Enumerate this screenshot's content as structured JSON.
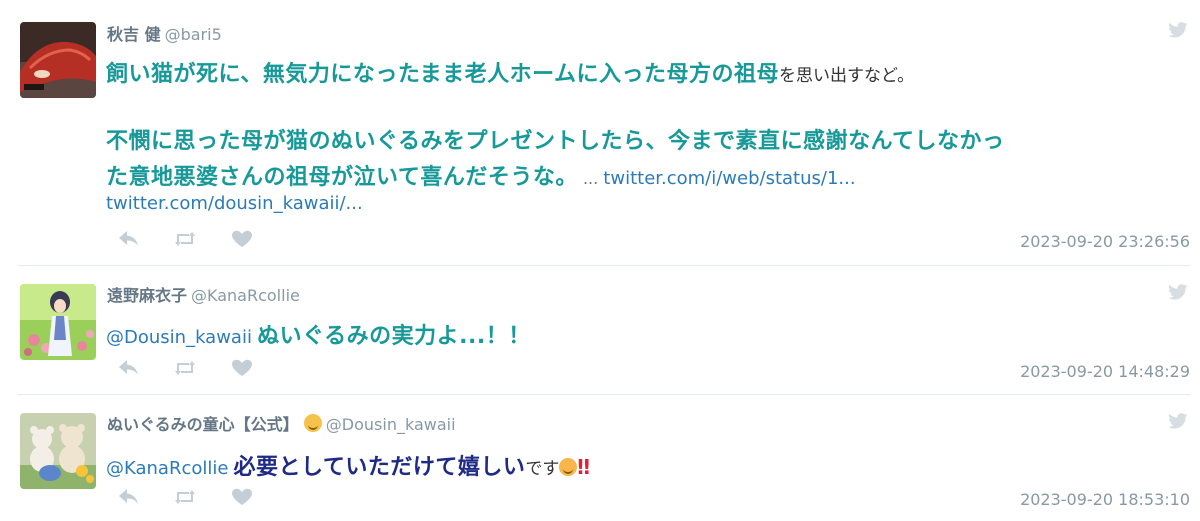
{
  "tweets": [
    {
      "name": "秋吉 健",
      "handle": "@bari5",
      "line1_highlight": "飼い猫が死に、無気力になったまま老人ホームに入った母方の祖母",
      "line1_plain": "を思い出すなど。",
      "line2_highlight": "不憫に思った母が猫のぬいぐるみをプレゼントしたら、今まで素直に感謝なんてしなかっ",
      "line3_highlight": "た意地悪婆さんの祖母が泣いて喜んだそうな。",
      "line3_ellipsis": "...",
      "line3_link": "twitter.com/i/web/status/1...",
      "line4_link": "twitter.com/dousin_kawaii/...",
      "timestamp": "2023-09-20 23:26:56"
    },
    {
      "name": "遠野麻衣子",
      "handle": "@KanaRcollie",
      "mention": "@Dousin_kawaii",
      "text_highlight": "ぬいぐるみの実力よ...！！",
      "timestamp": "2023-09-20 14:48:29"
    },
    {
      "name": "ぬいぐるみの童心【公式】",
      "handle": "@Dousin_kawaii",
      "mention": "@KanaRcollie",
      "text_highlight": "必要としていただけて嬉しい",
      "text_plain": "です",
      "text_bang": "‼",
      "timestamp": "2023-09-20 18:53:10"
    }
  ],
  "icons": {
    "reply": "reply-icon",
    "retweet": "retweet-icon",
    "like": "heart-icon",
    "brand": "twitter-bird-icon"
  },
  "colors": {
    "highlight_teal": "#17999a",
    "highlight_navy": "#1e2a86",
    "link": "#2b7bb9",
    "muted": "#8899a6",
    "icon": "#c4ced6"
  }
}
